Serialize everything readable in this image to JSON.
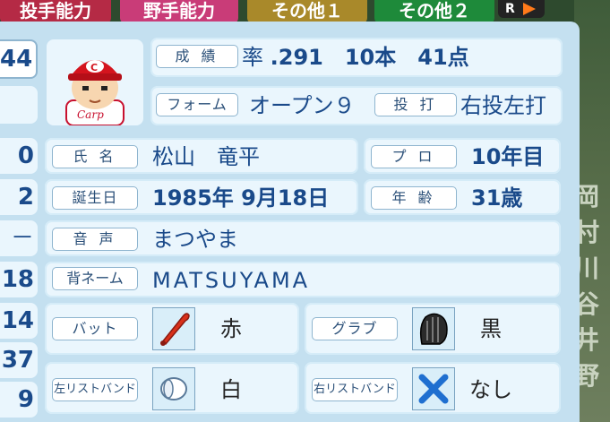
{
  "tabs": [
    "投手能力",
    "野手能力",
    "その他１",
    "その他２"
  ],
  "tab_icon_label": "R",
  "left_column": [
    "44",
    "",
    "0",
    "2",
    "－",
    "18",
    "14",
    "37",
    "9"
  ],
  "stats": {
    "label": "成 績",
    "rate_label": "率",
    "avg": ".291",
    "hr": "10本",
    "rbi": "41点"
  },
  "form": {
    "label": "フォーム",
    "value": "オープン９",
    "bt_label": "投 打",
    "bt_value": "右投左打"
  },
  "name": {
    "label": "氏 名",
    "value": "松山　竜平",
    "pro_label": "プ ロ",
    "pro_value": "10年目"
  },
  "birth": {
    "label": "誕生日",
    "value": "1985年 9月18日",
    "age_label": "年 齢",
    "age_value": "31歳"
  },
  "voice": {
    "label": "音 声",
    "value": "まつやま"
  },
  "back_name": {
    "label": "背ネーム",
    "value": "MATSUYAMA"
  },
  "bat": {
    "label": "バット",
    "value": "赤",
    "icon": "bat-icon"
  },
  "glove": {
    "label": "グラブ",
    "value": "黒",
    "icon": "glove-icon"
  },
  "left_wrist": {
    "label": "左リストバンド",
    "value": "白",
    "icon": "wristband-icon"
  },
  "right_wrist": {
    "label": "右リストバンド",
    "value": "なし",
    "icon": "none-x-icon"
  },
  "bg_chars": [
    "岡",
    "村",
    "川",
    "谷",
    "井",
    "野"
  ],
  "colors": {
    "accent": "#1a4a8a",
    "panel": "#c4e0f0",
    "row": "#eaf6fd"
  }
}
